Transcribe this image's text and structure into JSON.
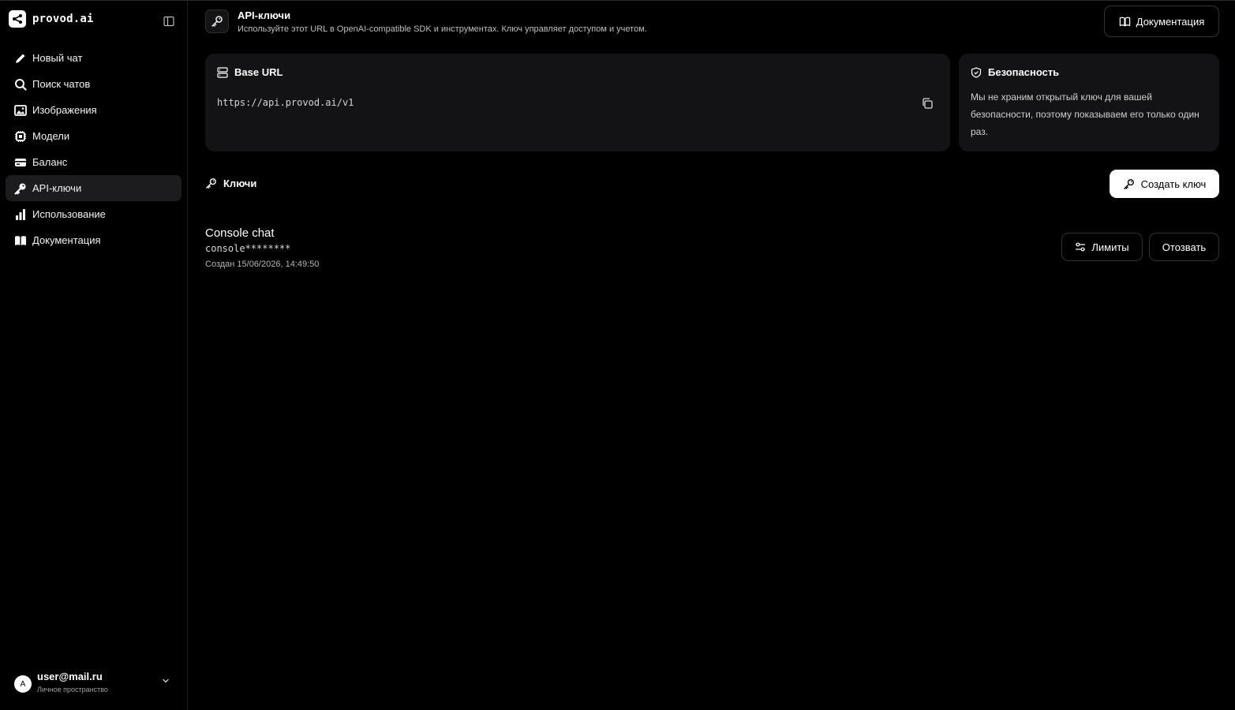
{
  "brand": {
    "name": "provod.ai",
    "logo_icon": "share-icon"
  },
  "sidebar": {
    "items": [
      {
        "label": "Новый чат",
        "icon": "pencil-icon",
        "active": false
      },
      {
        "label": "Поиск чатов",
        "icon": "search-icon",
        "active": false
      },
      {
        "label": "Изображения",
        "icon": "image-icon",
        "active": false
      },
      {
        "label": "Модели",
        "icon": "chip-icon",
        "active": false
      },
      {
        "label": "Баланс",
        "icon": "wallet-icon",
        "active": false
      },
      {
        "label": "API-ключи",
        "icon": "key-icon",
        "active": true
      },
      {
        "label": "Использование",
        "icon": "bar-chart-icon",
        "active": false
      },
      {
        "label": "Документация",
        "icon": "book-icon",
        "active": false
      }
    ]
  },
  "user": {
    "avatar_letter": "A",
    "email": "user@mail.ru",
    "space": "Личное пространство"
  },
  "header": {
    "title": "API-ключи",
    "subtitle": "Используйте этот URL в OpenAI-compatible SDK и инструментах. Ключ управляет доступом и учетом.",
    "docs_label": "Документация"
  },
  "base_url": {
    "title": "Base URL",
    "value": "https://api.provod.ai/v1"
  },
  "security": {
    "title": "Безопасность",
    "text": "Мы не храним открытый ключ для вашей безопасности, поэтому показываем его только один раз."
  },
  "keys": {
    "title": "Ключи",
    "create_label": "Создать ключ",
    "items": [
      {
        "name": "Console chat",
        "masked": "console********",
        "created": "Создан 15/06/2026, 14:49:50",
        "limits_label": "Лимиты",
        "revoke_label": "Отозвать"
      }
    ]
  },
  "colors": {
    "background": "#000000",
    "card": "#131315",
    "active_nav": "#1c1c1e",
    "primary_button": "#ffffff"
  }
}
